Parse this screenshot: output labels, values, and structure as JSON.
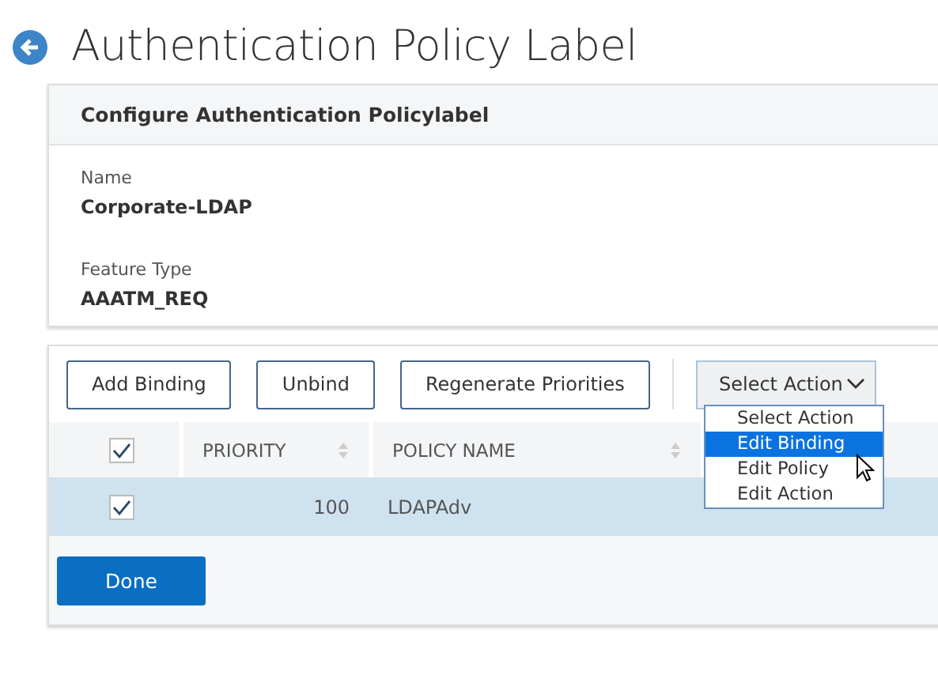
{
  "page_title": "Authentication Policy Label",
  "config_panel": {
    "title": "Configure Authentication Policylabel",
    "fields": [
      {
        "label": "Name",
        "value": "Corporate-LDAP"
      },
      {
        "label": "Feature Type",
        "value": "AAATM_REQ"
      }
    ]
  },
  "toolbar": {
    "buttons": [
      "Add Binding",
      "Unbind",
      "Regenerate Priorities"
    ],
    "action_select": {
      "value": "Select Action",
      "expanded": true,
      "options": [
        {
          "label": "Select Action",
          "highlighted": false
        },
        {
          "label": "Edit Binding",
          "highlighted": true
        },
        {
          "label": "Edit Policy",
          "highlighted": false
        },
        {
          "label": "Edit Action",
          "highlighted": false
        }
      ]
    }
  },
  "table": {
    "select_all_checked": true,
    "columns": [
      "PRIORITY",
      "POLICY NAME"
    ],
    "rows": [
      {
        "checked": true,
        "priority": "100",
        "policy_name": "LDAPAdv"
      }
    ]
  },
  "done_button": "Done"
}
